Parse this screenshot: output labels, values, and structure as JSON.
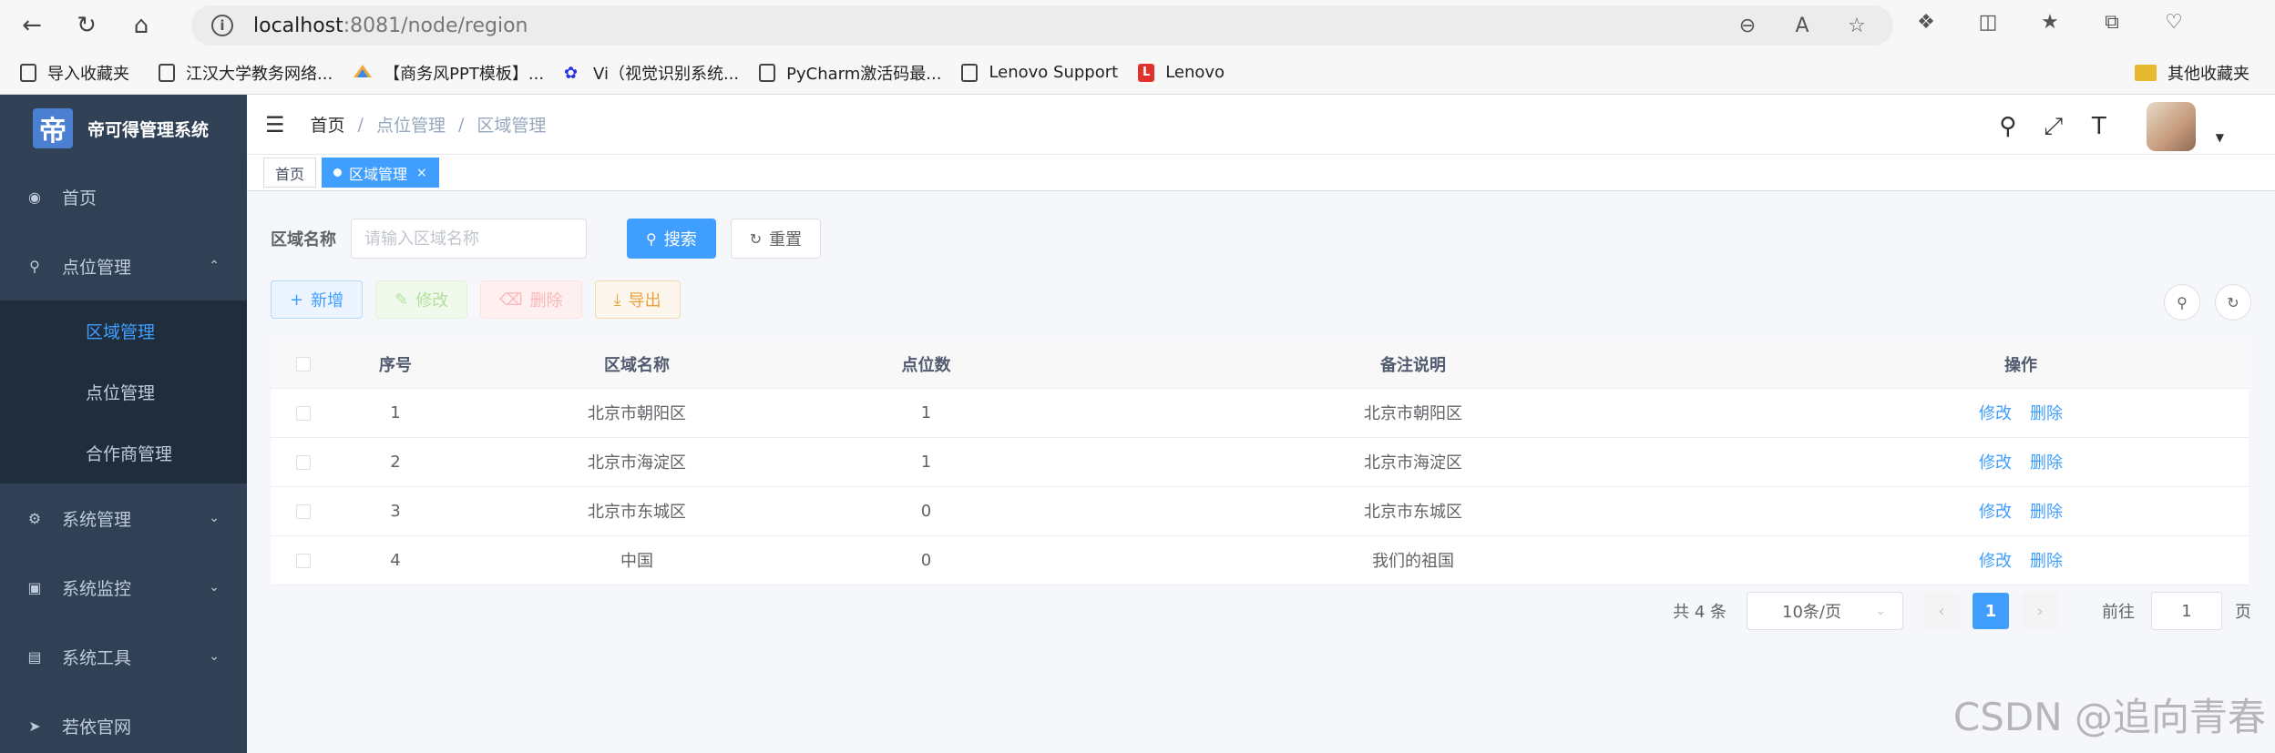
{
  "browser": {
    "url_host": "localhost",
    "url_rest": ":8081/node/region",
    "bookmarks": [
      {
        "label": "导入收藏夹"
      },
      {
        "label": "江汉大学教务网络..."
      },
      {
        "label": "【商务风PPT模板】..."
      },
      {
        "label": "Vi（视觉识别系统..."
      },
      {
        "label": "PyCharm激活码最..."
      },
      {
        "label": "Lenovo Support"
      },
      {
        "label": "Lenovo"
      }
    ],
    "other_bookmarks": "其他收藏夹"
  },
  "sidebar": {
    "logo_text": "帝",
    "title": "帝可得管理系统",
    "items": [
      {
        "label": "首页"
      },
      {
        "label": "点位管理"
      },
      {
        "label": "系统管理"
      },
      {
        "label": "系统监控"
      },
      {
        "label": "系统工具"
      },
      {
        "label": "若依官网"
      }
    ],
    "submenu": [
      {
        "label": "区域管理"
      },
      {
        "label": "点位管理"
      },
      {
        "label": "合作商管理"
      }
    ]
  },
  "breadcrumb": [
    "首页",
    "点位管理",
    "区域管理"
  ],
  "tags": [
    {
      "label": "首页"
    },
    {
      "label": "区域管理"
    }
  ],
  "search": {
    "label": "区域名称",
    "placeholder": "请输入区域名称",
    "search_label": "搜索",
    "reset_label": "重置"
  },
  "toolbar": {
    "add": "新增",
    "edit": "修改",
    "delete": "删除",
    "export": "导出"
  },
  "table": {
    "headers": [
      "序号",
      "区域名称",
      "点位数",
      "备注说明",
      "操作"
    ],
    "rows": [
      {
        "idx": "1",
        "name": "北京市朝阳区",
        "count": "1",
        "remark": "北京市朝阳区"
      },
      {
        "idx": "2",
        "name": "北京市海淀区",
        "count": "1",
        "remark": "北京市海淀区"
      },
      {
        "idx": "3",
        "name": "北京市东城区",
        "count": "0",
        "remark": "北京市东城区"
      },
      {
        "idx": "4",
        "name": "中国",
        "count": "0",
        "remark": "我们的祖国"
      }
    ],
    "op_edit": "修改",
    "op_delete": "删除"
  },
  "pagination": {
    "total": "共 4 条",
    "page_size": "10条/页",
    "current": "1",
    "goto": "前往",
    "jump_value": "1",
    "page_suffix": "页"
  },
  "watermark": "CSDN @追向青春",
  "colors": {
    "sidebar_bg": "#304156",
    "submenu_bg": "#1f2d3d",
    "primary": "#409eff"
  }
}
